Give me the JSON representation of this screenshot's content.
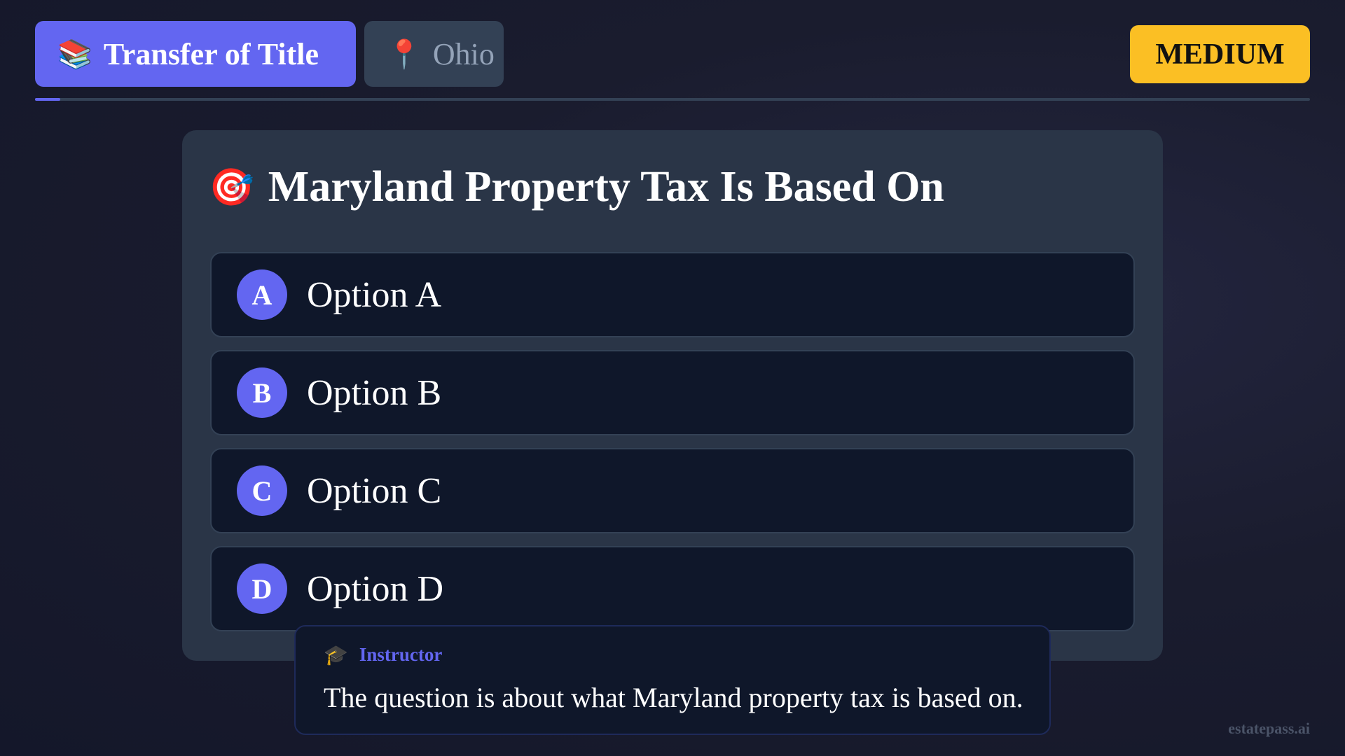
{
  "header": {
    "topic": {
      "icon": "books-icon",
      "glyph": "📚",
      "label": "Transfer of Title"
    },
    "state": {
      "icon": "pin-icon",
      "glyph": "📍",
      "label": "Ohio"
    },
    "difficulty": {
      "label": "MEDIUM",
      "color": "#fbbf24"
    }
  },
  "progress": {
    "fraction": 0.02
  },
  "question": {
    "icon": "target-icon",
    "glyph": "🎯",
    "title": "Maryland Property Tax Is Based On",
    "options": [
      {
        "letter": "A",
        "text": "Option A"
      },
      {
        "letter": "B",
        "text": "Option B"
      },
      {
        "letter": "C",
        "text": "Option C"
      },
      {
        "letter": "D",
        "text": "Option D"
      }
    ]
  },
  "instructor": {
    "icon": "graduation-cap-icon",
    "glyph": "🎓",
    "role": "Instructor",
    "message": "The question is about what Maryland property tax is based on."
  },
  "watermark": "estatepass.ai",
  "colors": {
    "accent": "#6366f1",
    "card": "#2a3547",
    "option_bg": "#0f172a",
    "difficulty": "#fbbf24"
  }
}
